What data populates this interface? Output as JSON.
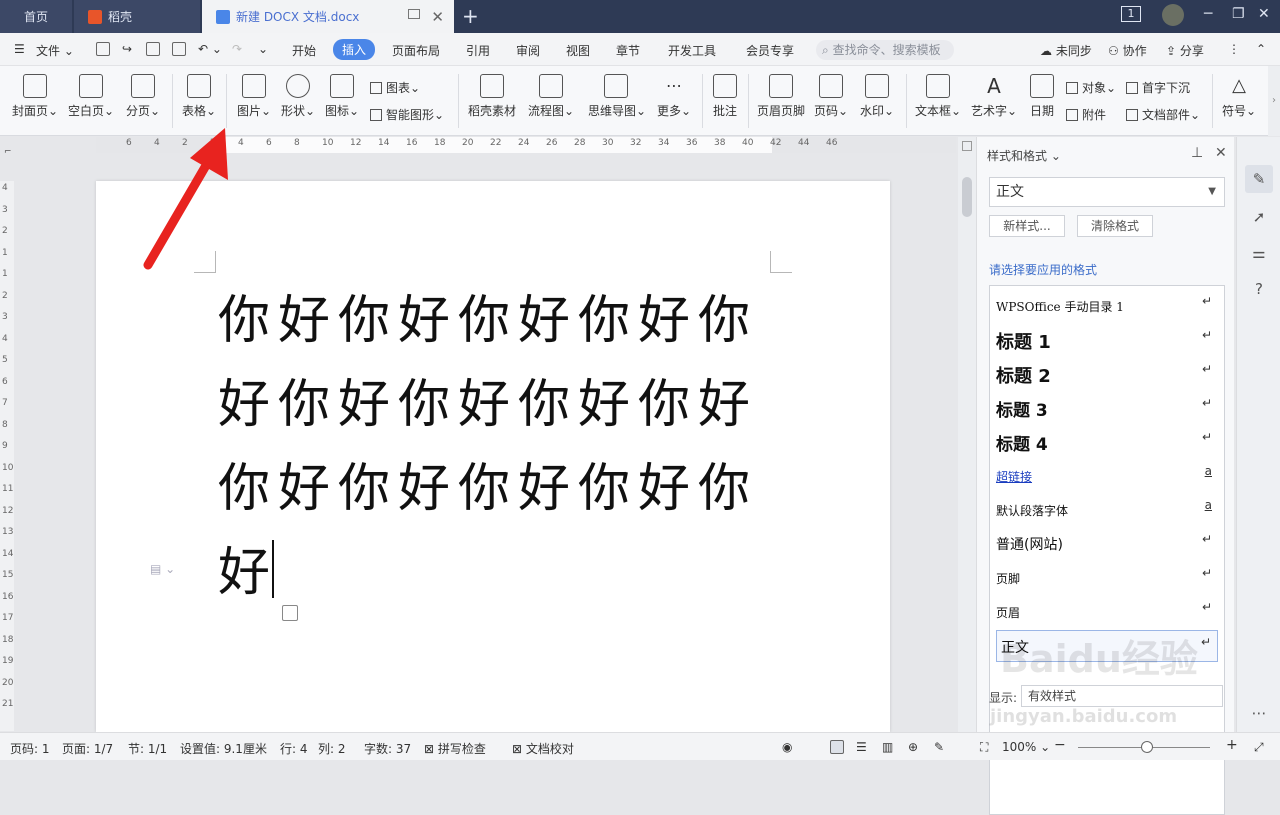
{
  "titlebar": {
    "home_tab": "首页",
    "daoke_tab": "稻壳",
    "doc_tab": "新建 DOCX 文档.docx",
    "badge": "1"
  },
  "menubar": {
    "file": "文件",
    "items": [
      "开始",
      "插入",
      "页面布局",
      "引用",
      "审阅",
      "视图",
      "章节",
      "开发工具",
      "会员专享"
    ],
    "active": "插入",
    "search_placeholder": "查找命令、搜索模板",
    "right": [
      "未同步",
      "协作",
      "分享"
    ]
  },
  "ribbon": {
    "cover": "封面页",
    "blank": "空白页",
    "pagebreak": "分页",
    "table": "表格",
    "picture": "图片",
    "shape": "形状",
    "icon": "图标",
    "chart": "图表",
    "smartart": "智能图形",
    "daoke": "稻壳素材",
    "flow": "流程图",
    "mind": "思维导图",
    "more": "更多",
    "comment": "批注",
    "header_footer": "页眉页脚",
    "page_num": "页码",
    "watermark": "水印",
    "textbox": "文本框",
    "wordart": "艺术字",
    "date": "日期",
    "object": "对象",
    "dropcap": "首字下沉",
    "attachment": "附件",
    "docpart": "文档部件",
    "symbol": "符号"
  },
  "ruler": {
    "h_ticks": [
      "6",
      "4",
      "2",
      "2",
      "4",
      "6",
      "8",
      "10",
      "12",
      "14",
      "16",
      "18",
      "20",
      "22",
      "24",
      "26",
      "28",
      "30",
      "32",
      "34",
      "36",
      "38",
      "40",
      "42",
      "44",
      "46"
    ],
    "v_ticks": [
      "4",
      "3",
      "2",
      "1",
      "1",
      "2",
      "3",
      "4",
      "5",
      "6",
      "7",
      "8",
      "9",
      "10",
      "11",
      "12",
      "13",
      "14",
      "15",
      "16",
      "17",
      "18",
      "19",
      "20",
      "21"
    ]
  },
  "document": {
    "text": "你好你好你好你好你好你好你好你好你好你好你好你好你好你好"
  },
  "pane": {
    "title": "样式和格式",
    "current_style": "正文",
    "new_style": "新样式...",
    "clear_format": "清除格式",
    "hint": "请选择要应用的格式",
    "styles": [
      {
        "name": "WPSOffice 手动目录 1",
        "mark": "↵"
      },
      {
        "name": "标题 1",
        "mark": "↵"
      },
      {
        "name": "标题 2",
        "mark": "↵"
      },
      {
        "name": "标题 3",
        "mark": "↵"
      },
      {
        "name": "标题 4",
        "mark": "↵"
      },
      {
        "name": "超链接",
        "mark": "a"
      },
      {
        "name": "默认段落字体",
        "mark": "a"
      },
      {
        "name": "普通(网站)",
        "mark": "↵"
      },
      {
        "name": "页脚",
        "mark": "↵"
      },
      {
        "name": "页眉",
        "mark": "↵"
      },
      {
        "name": "正文",
        "mark": "↵"
      }
    ],
    "show_label": "显示:",
    "show_value": "有效样式"
  },
  "status": {
    "page": "页码: 1",
    "pages": "页面: 1/7",
    "section": "节: 1/1",
    "setting": "设置值: 9.1厘米",
    "row": "行: 4",
    "col": "列: 2",
    "words": "字数: 37",
    "spell": "拼写检查",
    "proof": "文档校对",
    "zoom": "100%"
  },
  "watermark": {
    "logo": "Baidu经验",
    "url": "jingyan.baidu.com"
  },
  "colors": {
    "accent": "#4a86e8",
    "titlebar": "#2e3a55",
    "arrow": "#e8231f"
  }
}
